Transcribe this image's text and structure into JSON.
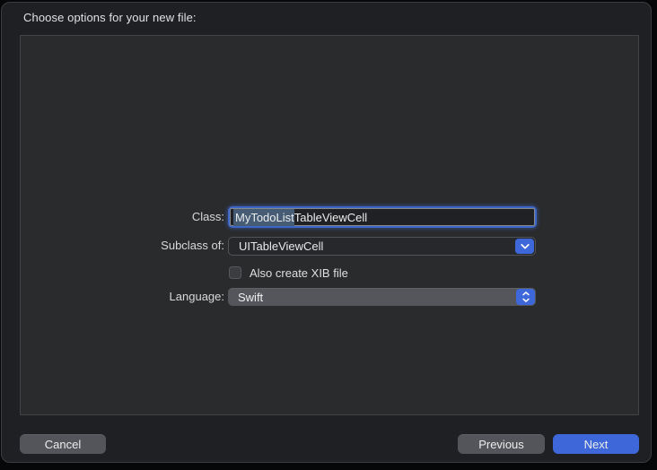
{
  "window": {
    "title": "Choose options for your new file:"
  },
  "form": {
    "class_field": {
      "label": "Class:",
      "value": "MyTodoListTableViewCell",
      "value_selected_part": "MyTodoList",
      "value_unselected_part": "TableViewCell",
      "focused": true
    },
    "subclass_field": {
      "label": "Subclass of:",
      "value": "UITableViewCell",
      "icon": "chevron-down-icon"
    },
    "xib_checkbox": {
      "label": "Also create XIB file",
      "checked": false
    },
    "language_select": {
      "label": "Language:",
      "value": "Swift",
      "icon": "chevron-up-down-icon"
    }
  },
  "buttons": {
    "cancel": "Cancel",
    "previous": "Previous",
    "next": "Next"
  },
  "colors": {
    "accent_blue": "#3e67d9",
    "text_selection": "#455c74",
    "window_background": "#1e2023",
    "panel_background": "#2a2b2d",
    "focus_ring": "#3d66c6"
  }
}
